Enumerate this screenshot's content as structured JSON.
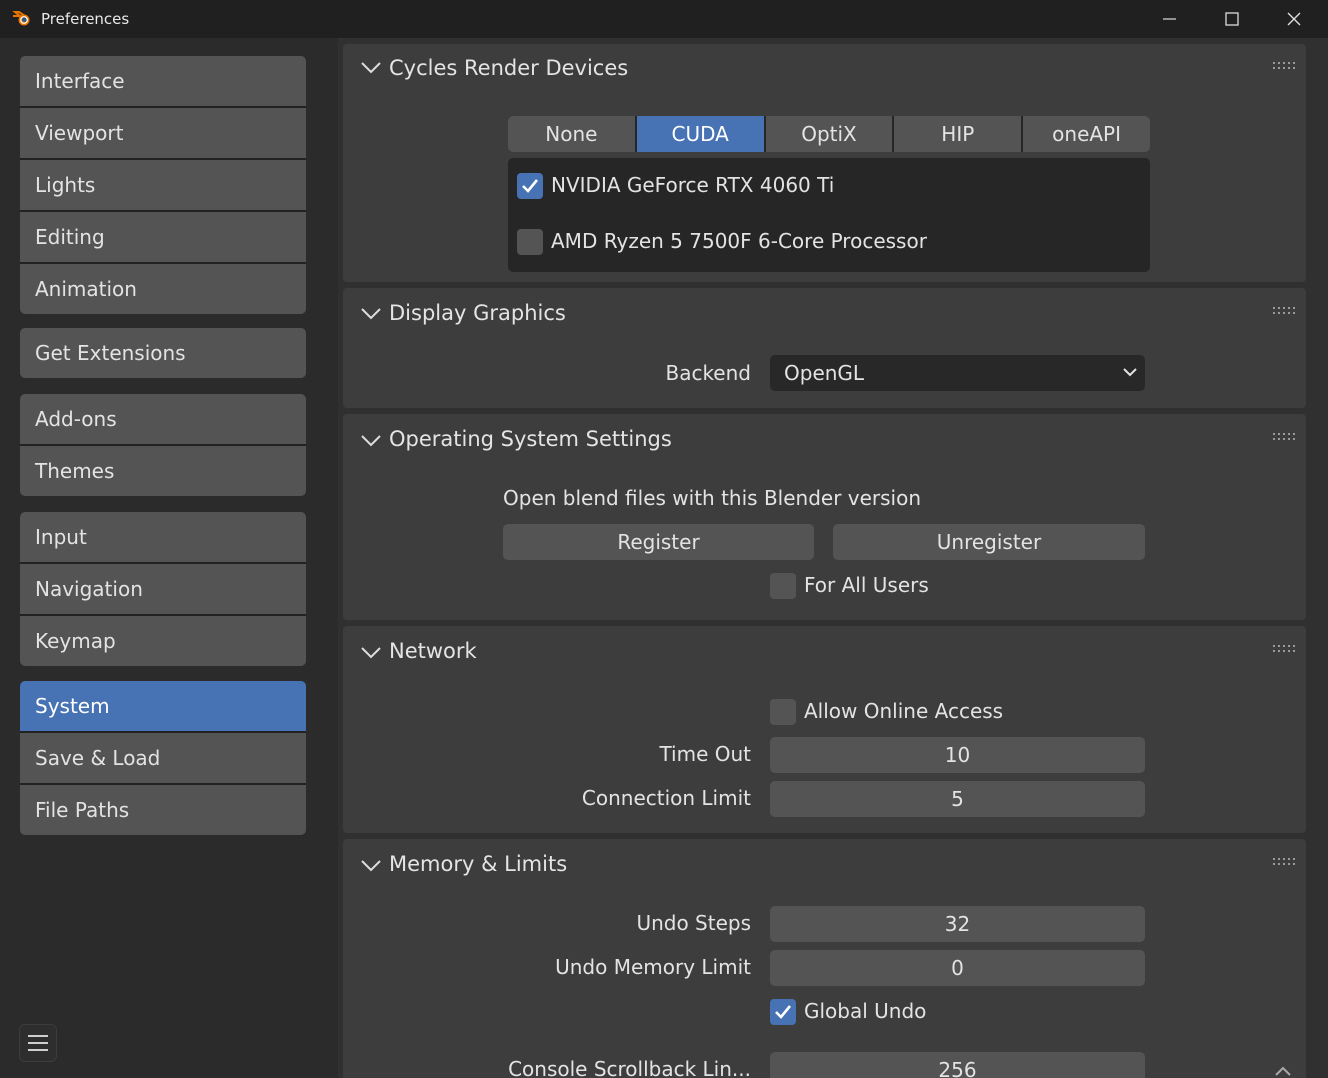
{
  "window": {
    "title": "Preferences"
  },
  "sidebar": {
    "groups": [
      [
        "Interface",
        "Viewport",
        "Lights",
        "Editing",
        "Animation"
      ],
      [
        "Get Extensions"
      ],
      [
        "Add-ons",
        "Themes"
      ],
      [
        "Input",
        "Navigation",
        "Keymap"
      ],
      [
        "System",
        "Save & Load",
        "File Paths"
      ]
    ],
    "active": "System"
  },
  "cycles": {
    "title": "Cycles Render Devices",
    "backends": [
      "None",
      "CUDA",
      "OptiX",
      "HIP",
      "oneAPI"
    ],
    "selected_backend": "CUDA",
    "devices": [
      {
        "name": "NVIDIA GeForce RTX 4060 Ti",
        "checked": true
      },
      {
        "name": "AMD Ryzen 5 7500F 6-Core Processor",
        "checked": false
      }
    ]
  },
  "display": {
    "title": "Display Graphics",
    "backend_label": "Backend",
    "backend_value": "OpenGL"
  },
  "os": {
    "title": "Operating System Settings",
    "description": "Open blend files with this Blender version",
    "register": "Register",
    "unregister": "Unregister",
    "all_users_label": "For All Users",
    "all_users_checked": false
  },
  "network": {
    "title": "Network",
    "online_label": "Allow Online Access",
    "online_checked": false,
    "timeout_label": "Time Out",
    "timeout_value": "10",
    "conn_label": "Connection Limit",
    "conn_value": "5"
  },
  "memory": {
    "title": "Memory & Limits",
    "undo_steps_label": "Undo Steps",
    "undo_steps_value": "32",
    "undo_mem_label": "Undo Memory Limit",
    "undo_mem_value": "0",
    "global_undo_label": "Global Undo",
    "global_undo_checked": true,
    "console_label": "Console Scrollback Lin...",
    "console_value": "256"
  },
  "colors": {
    "accent": "#4772b3",
    "button": "#545454",
    "panel": "#3d3d3d"
  }
}
